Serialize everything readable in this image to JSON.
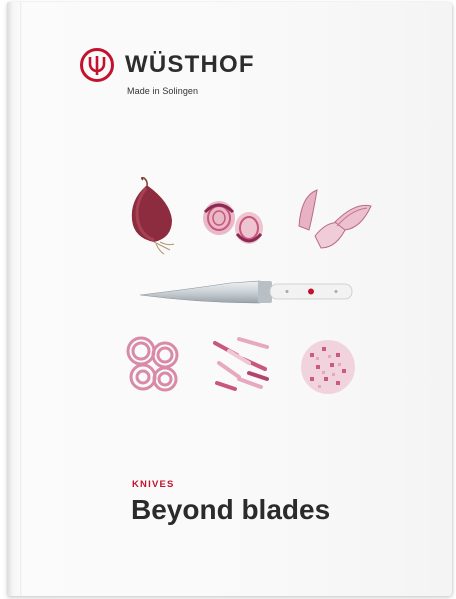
{
  "brand": {
    "name": "WÜSTHOF",
    "tagline": "Made in Solingen"
  },
  "cover": {
    "category": "KNIVES",
    "headline": "Beyond blades"
  },
  "colors": {
    "brand_red": "#c3122e",
    "text_dark": "#2b2b2b",
    "onion_purple": "#8a2a52"
  },
  "icons": {
    "logo": "trident-circle-icon"
  }
}
